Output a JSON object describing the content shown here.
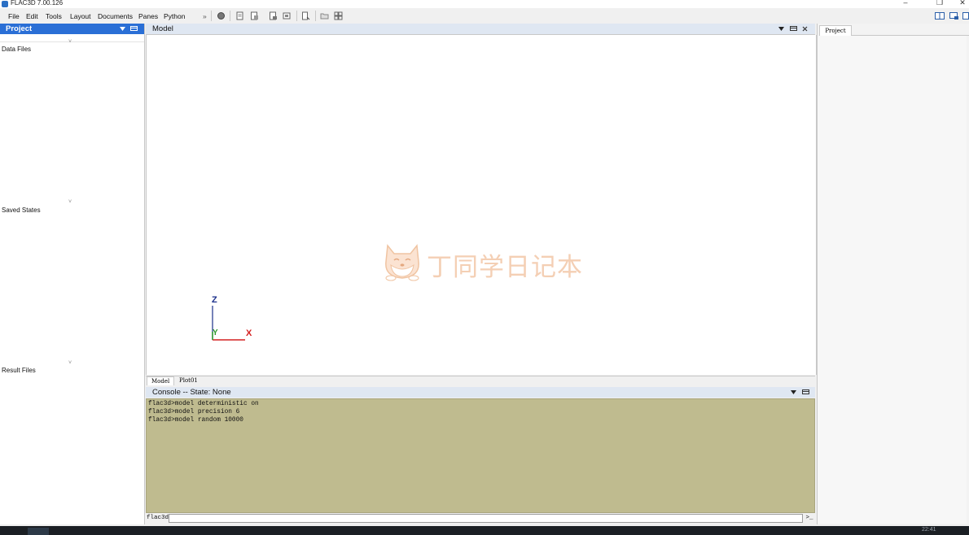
{
  "window": {
    "title": "FLAC3D 7.00.126",
    "minimize_glyph": "–",
    "maximize_glyph": "❐",
    "close_glyph": "✕"
  },
  "menu": {
    "items": [
      "File",
      "Edit",
      "Tools",
      "Layout",
      "Documents",
      "Panes",
      "Python"
    ],
    "overflow": "»"
  },
  "toolbar": {
    "icons": [
      "record-icon",
      "new-document-icon",
      "open-document-icon",
      "save-icon",
      "save-all-icon",
      "export-icon",
      "folder-icon",
      "plot-icon"
    ]
  },
  "left_pane": {
    "title": "Project",
    "sections": [
      {
        "label": "Data Files",
        "caret": "˅"
      },
      {
        "label": "Saved States",
        "caret": "˅"
      },
      {
        "label": "Result Files",
        "caret": "˅"
      }
    ]
  },
  "model_pane": {
    "title": "Model",
    "tabs": [
      {
        "label": "Model",
        "active": true
      },
      {
        "label": "Plot01",
        "active": false
      }
    ],
    "axes": {
      "x": "X",
      "y": "Y",
      "z": "Z",
      "x_color": "#d42020",
      "y_color": "#2a9a2a",
      "z_color": "#1a2e8a"
    }
  },
  "console": {
    "title": "Console -- State: None",
    "lines": [
      "flac3d>model deterministic on",
      "flac3d>model precision 6",
      "flac3d>model random 10000"
    ],
    "prompt": "flac3d>",
    "input_value": "",
    "run_glyph": ">_"
  },
  "right_pane": {
    "tab": "Project"
  },
  "watermark": {
    "text": "丁同学日记本"
  },
  "taskbar": {
    "clock": "22:41"
  },
  "colors": {
    "accent": "#2a6fd6",
    "console_bg": "#bfbb8f",
    "pane_header": "#dfe7f2"
  }
}
